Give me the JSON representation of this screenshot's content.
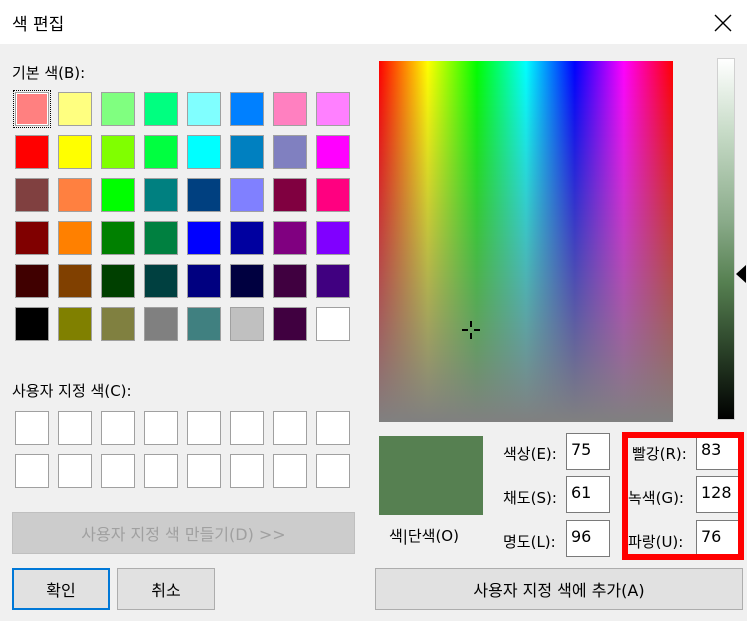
{
  "window": {
    "title": "색 편집"
  },
  "basic_colors": {
    "label": "기본 색(B):",
    "rows": [
      [
        "#ff8080",
        "#ffff80",
        "#80ff80",
        "#00ff80",
        "#80ffff",
        "#0080ff",
        "#ff80c0",
        "#ff80ff"
      ],
      [
        "#ff0000",
        "#ffff00",
        "#80ff00",
        "#00ff40",
        "#00ffff",
        "#0080c0",
        "#8080c0",
        "#ff00ff"
      ],
      [
        "#804040",
        "#ff8040",
        "#00ff00",
        "#008080",
        "#004080",
        "#8080ff",
        "#800040",
        "#ff0080"
      ],
      [
        "#800000",
        "#ff8000",
        "#008000",
        "#008040",
        "#0000ff",
        "#0000a0",
        "#800080",
        "#8000ff"
      ],
      [
        "#400000",
        "#804000",
        "#004000",
        "#004040",
        "#000080",
        "#000040",
        "#400040",
        "#400080"
      ],
      [
        "#000000",
        "#808000",
        "#808040",
        "#808080",
        "#408080",
        "#c0c0c0",
        "#400040",
        "#ffffff"
      ]
    ]
  },
  "custom_colors": {
    "label": "사용자 지정 색(C):"
  },
  "buttons": {
    "define_custom": "사용자 지정 색 만들기(D) >>",
    "ok": "확인",
    "cancel": "취소",
    "add_custom": "사용자 지정 색에 추가(A)"
  },
  "preview": {
    "label": "색|단색(O)",
    "color": "#568051"
  },
  "fields": {
    "hue": {
      "label": "색상(E):",
      "value": "75"
    },
    "sat": {
      "label": "채도(S):",
      "value": "61"
    },
    "lum": {
      "label": "명도(L):",
      "value": "96"
    },
    "red": {
      "label": "빨강(R):",
      "value": "83"
    },
    "green": {
      "label": "녹색(G):",
      "value": "128"
    },
    "blue": {
      "label": "파랑(U):",
      "value": "76"
    }
  },
  "colors": {
    "highlight": "#ff0000",
    "focus_border": "#0078d7"
  }
}
